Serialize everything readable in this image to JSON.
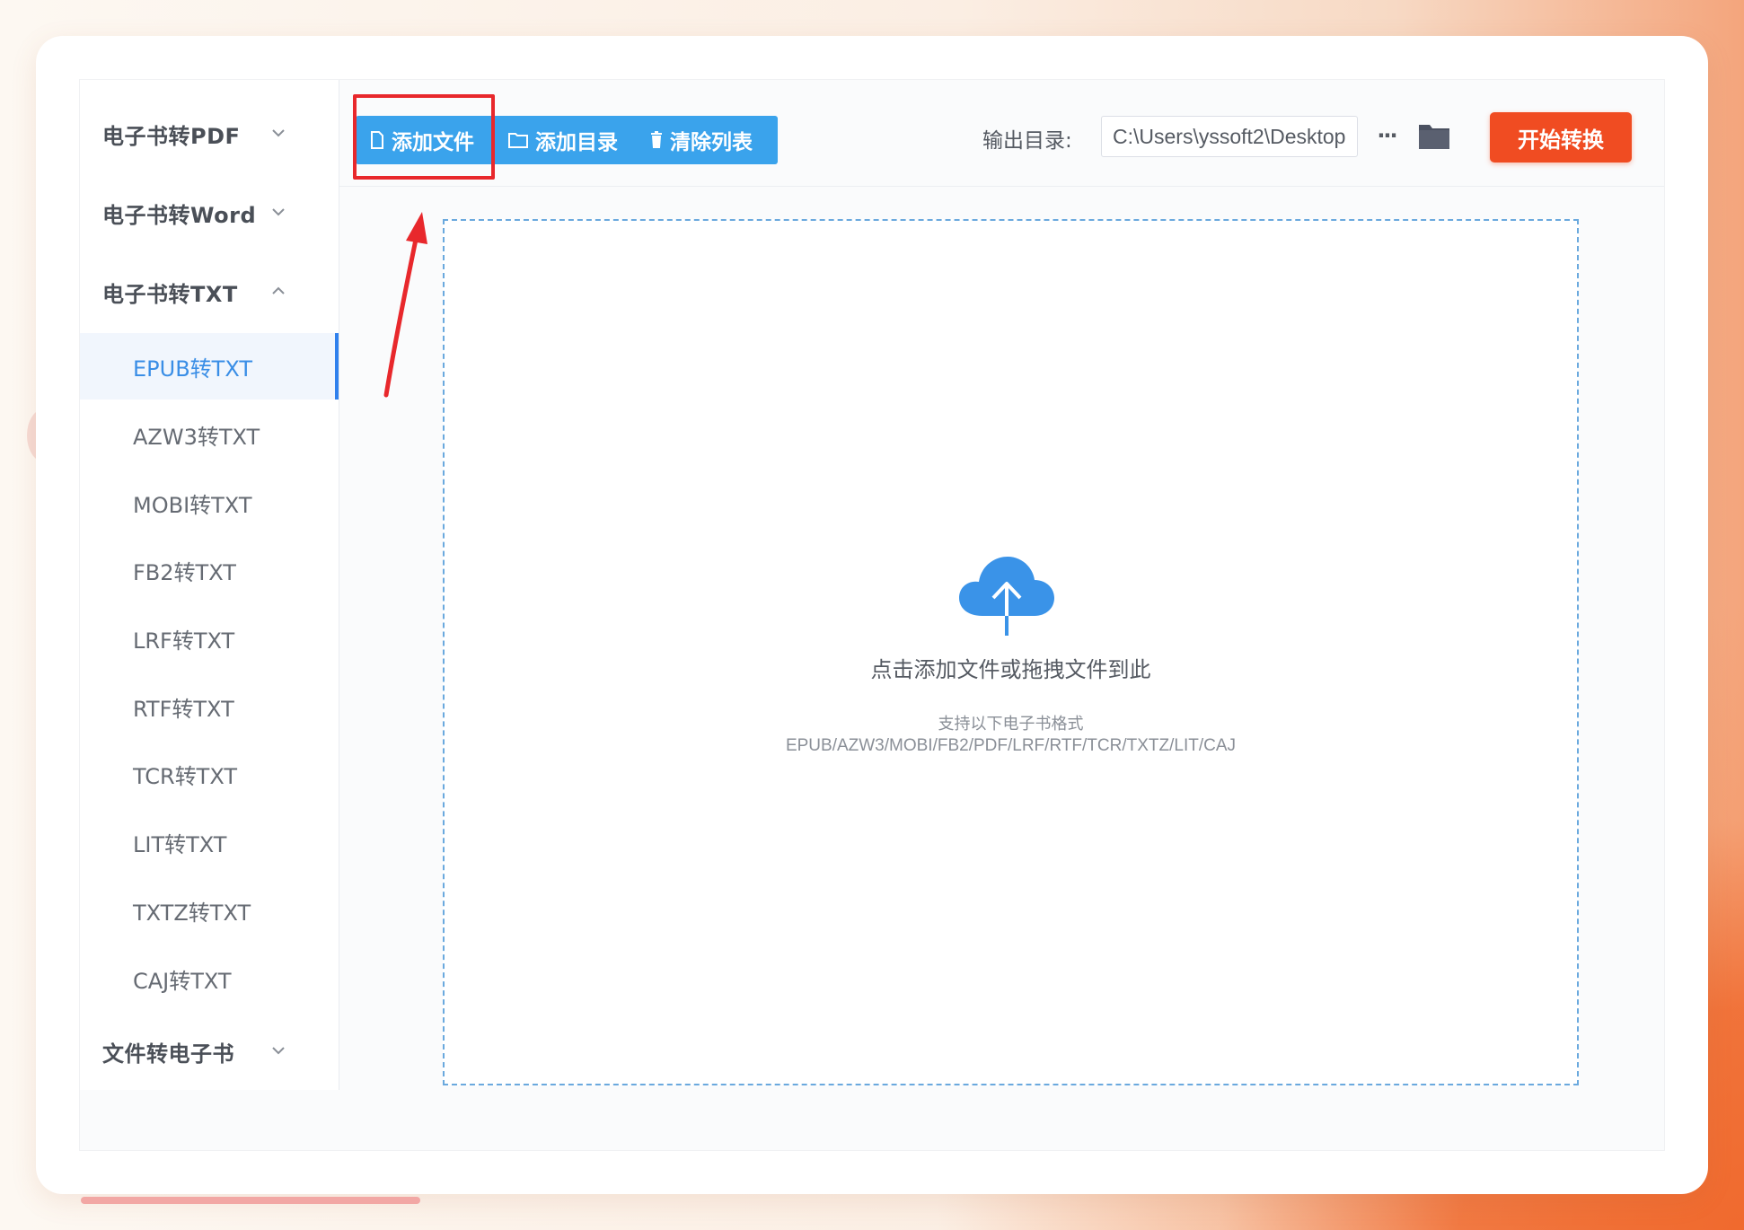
{
  "sidebar": {
    "groups": [
      {
        "label": "电子书转PDF",
        "expanded": false
      },
      {
        "label": "电子书转Word",
        "expanded": false
      },
      {
        "label": "电子书转TXT",
        "expanded": true
      },
      {
        "label": "文件转电子书",
        "expanded": false
      }
    ],
    "items": [
      {
        "label": "EPUB转TXT",
        "active": true
      },
      {
        "label": "AZW3转TXT"
      },
      {
        "label": "MOBI转TXT"
      },
      {
        "label": "FB2转TXT"
      },
      {
        "label": "LRF转TXT"
      },
      {
        "label": "RTF转TXT"
      },
      {
        "label": "TCR转TXT"
      },
      {
        "label": "LIT转TXT"
      },
      {
        "label": "TXTZ转TXT"
      },
      {
        "label": "CAJ转TXT"
      }
    ]
  },
  "toolbar": {
    "add_file": "添加文件",
    "add_dir": "添加目录",
    "clear_list": "清除列表",
    "output_label": "输出目录:",
    "output_path": "C:\\Users\\yssoft2\\Desktop",
    "more": "···",
    "start": "开始转换"
  },
  "dropzone": {
    "title": "点击添加文件或拖拽文件到此",
    "sub": "支持以下电子书格式",
    "formats": "EPUB/AZW3/MOBI/FB2/PDF/LRF/RTF/TCR/TXTZ/LIT/CAJ"
  },
  "colors": {
    "accent": "#3aa3ec",
    "active_text": "#3a8ee6",
    "start_button": "#f04c22",
    "annotation_red": "#e8282c"
  },
  "icons": [
    "file-icon",
    "folder-outline-icon",
    "trash-icon",
    "more-icon",
    "folder-icon",
    "cloud-upload-icon",
    "chevron-down-icon",
    "chevron-up-icon"
  ]
}
